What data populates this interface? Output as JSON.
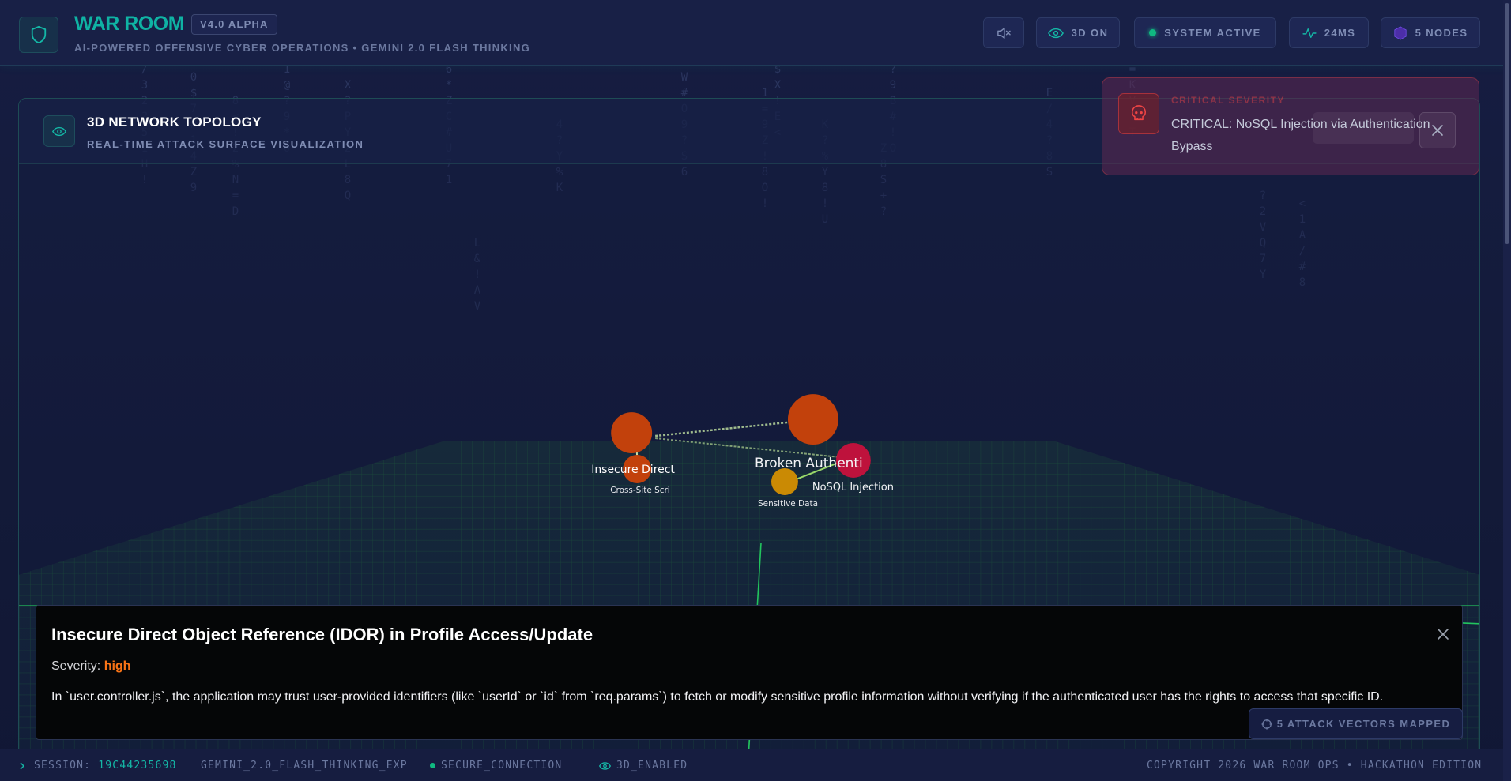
{
  "header": {
    "title": "WAR ROOM",
    "version": "V4.0 ALPHA",
    "subtitle": "AI-POWERED OFFENSIVE CYBER OPERATIONS • GEMINI 2.0 FLASH THINKING",
    "btn_3d": "3D ON",
    "btn_status": "SYSTEM ACTIVE",
    "btn_latency": "24MS",
    "btn_nodes": "5 NODES"
  },
  "panel": {
    "title": "3D NETWORK TOPOLOGY",
    "subtitle": "REAL-TIME ATTACK SURFACE VISUALIZATION"
  },
  "topology": {
    "labels": {
      "insecure_direct": "Insecure Direct",
      "cross_site": "Cross-Site Scri",
      "broken_auth": "Broken Authenti",
      "nosql": "NoSQL Injection",
      "sensitive": "Sensitive Data"
    }
  },
  "alert": {
    "label": "CRITICAL SEVERITY",
    "message": "CRITICAL: NoSQL Injection via Authentication Bypass"
  },
  "detail": {
    "title": "Insecure Direct Object Reference (IDOR) in Profile Access/Update",
    "severity_label": "Severity: ",
    "severity_value": "high",
    "description": "In `user.controller.js`, the application may trust user-provided identifiers (like `userId` or `id` from `req.params`) to fetch or modify sensitive profile information without verifying if the authenticated user has the rights to access that specific ID."
  },
  "vectors_badge": "5 ATTACK VECTORS MAPPED",
  "footer": {
    "session_label": "SESSION: ",
    "session_id": "19C44235698",
    "model": "GEMINI_2.0_FLASH_THINKING_EXP",
    "connection": "SECURE_CONNECTION",
    "mode": "3D_ENABLED",
    "copyright": "COPYRIGHT 2026 WAR ROOM OPS • HACKATHON EDITION"
  },
  "colors": {
    "accent": "#0fb3a4",
    "status_green": "#10b981",
    "severity_high": "#f97316",
    "critical": "#dc2626"
  }
}
